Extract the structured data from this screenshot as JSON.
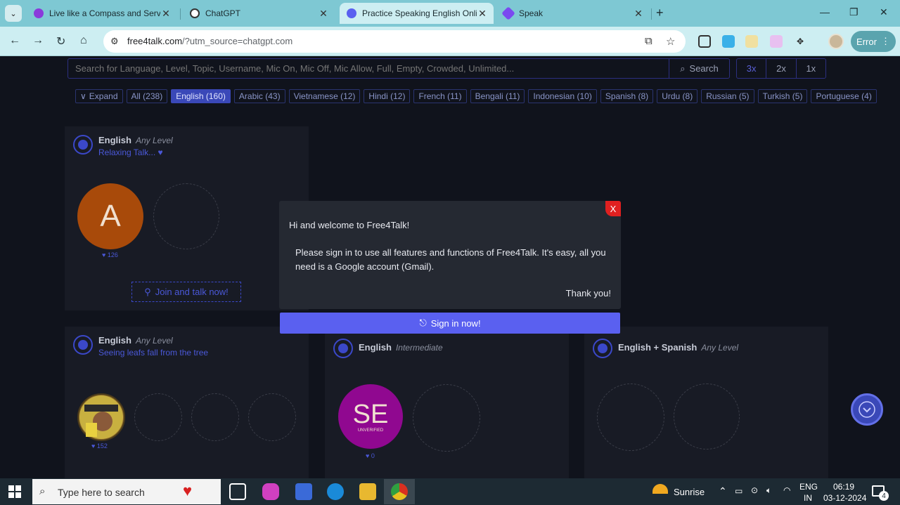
{
  "browser": {
    "tabs": [
      {
        "title": "Live like a Compass and Serve a",
        "favicon_color": "#8a3adb"
      },
      {
        "title": "ChatGPT",
        "favicon_color": "#ffffff"
      },
      {
        "title": "Practice Speaking English Onlin",
        "favicon_color": "#5a60f0"
      },
      {
        "title": "Speak",
        "favicon_color": "#7a4af0"
      }
    ],
    "new_tab": "+",
    "url_host": "free4talk.com",
    "url_rest": "/?utm_source=chatgpt.com",
    "error_label": "Error"
  },
  "page": {
    "search": {
      "placeholder": "Search for Language, Level, Topic, Username, Mic On, Mic Off, Mic Allow, Full, Empty, Crowded, Unlimited...",
      "button_label": "Search"
    },
    "zoom_options": [
      "3x",
      "2x",
      "1x"
    ],
    "filters": [
      "Expand",
      "All (238)",
      "English (160)",
      "Arabic (43)",
      "Vietnamese (12)",
      "Hindi (12)",
      "French (11)",
      "Bengali (11)",
      "Indonesian (10)",
      "Spanish (8)",
      "Urdu (8)",
      "Russian (5)",
      "Turkish (5)",
      "Portuguese (4)"
    ],
    "rooms": [
      {
        "language": "English",
        "level": "Any Level",
        "topic": "Relaxing Talk... ♥",
        "avatar_letter": "A",
        "likes": "♥ 126",
        "join_label": "Join and talk now!"
      },
      {
        "language": "English",
        "level": "Any Level",
        "topic": "Seeing leafs fall from the tree",
        "likes": "♥ 152"
      },
      {
        "language": "English",
        "level": "Intermediate",
        "avatar_letter": "SE",
        "avatar_sub": "UNVERIFIED",
        "likes": "♥ 0"
      },
      {
        "language": "English + Spanish",
        "level": "Any Level"
      }
    ]
  },
  "modal": {
    "greeting": "Hi and welcome to Free4Talk!",
    "body": "Please sign in to use all features and functions of Free4Talk. It's easy, all you need is a Google account (Gmail).",
    "thanks": "Thank you!",
    "close": "X",
    "signin_label": "Sign in now!"
  },
  "taskbar": {
    "search_placeholder": "Type here to search",
    "weather": "Sunrise",
    "lang_top": "ENG",
    "lang_bottom": "IN",
    "time": "06:19",
    "date": "03-12-2024",
    "notifications": "4"
  }
}
